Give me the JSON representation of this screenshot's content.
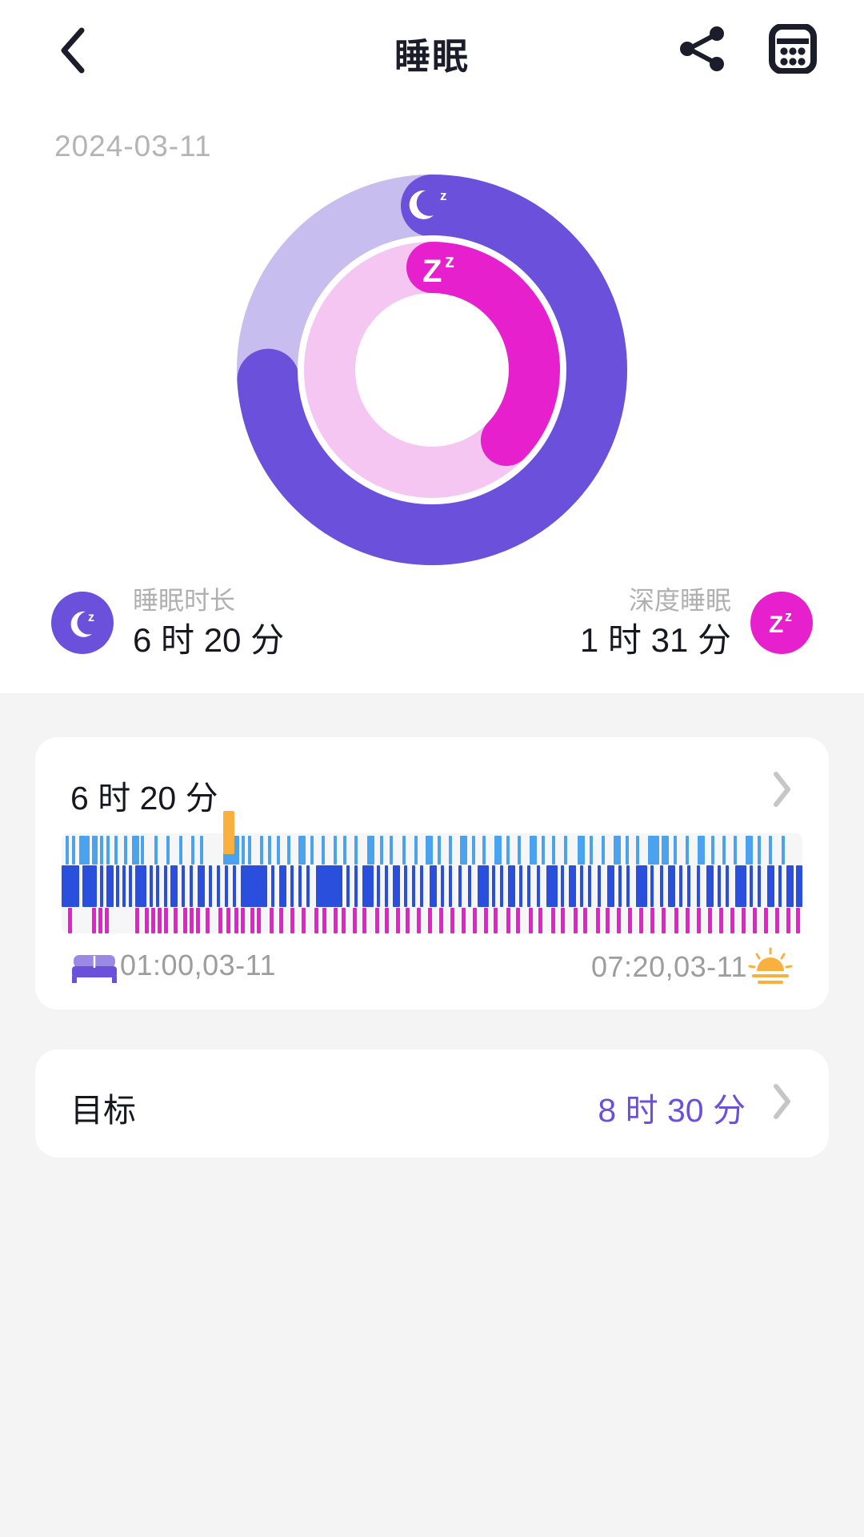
{
  "header": {
    "title": "睡眠",
    "back_icon": "chevron-left-icon",
    "share_icon": "share-icon",
    "calendar_icon": "calendar-icon"
  },
  "date": "2024-03-11",
  "rings": {
    "sleep_badge_icon": "moon-z-icon",
    "deep_badge_icon": "zz-icon",
    "outer_track_color": "#c7bdee",
    "outer_fill_color": "#6b50dc",
    "inner_track_color": "#f4c6f1",
    "inner_fill_color": "#e520cc"
  },
  "stats": [
    {
      "icon": "moon-z-icon",
      "label": "睡眠时长",
      "value": "6 时 20 分",
      "color": "#6b50dc"
    },
    {
      "icon": "zz-icon",
      "label": "深度睡眠",
      "value": "1 时 31 分",
      "color": "#e520cc"
    }
  ],
  "sleep_card": {
    "title": "6 时 20 分",
    "chevron_icon": "chevron-right-icon",
    "start_icon": "bed-icon",
    "start_time": "01:00,03-11",
    "end_time": "07:20,03-11",
    "end_icon": "sunrise-icon"
  },
  "goal_card": {
    "label": "目标",
    "value": "8 时 30 分",
    "chevron_icon": "chevron-right-icon"
  },
  "chart_data": {
    "type": "bar",
    "title": "睡眠阶段 (Sleep stages hypnogram)",
    "xlabel": "",
    "ylabel": "",
    "x_start": "01:00,03-11",
    "x_end": "07:20,03-11",
    "grid": false,
    "legend_position": "none",
    "stage_colors": {
      "awake": "#4ba3ef",
      "light": "#2b4fdd",
      "deep": "#e520cc",
      "marker": "#f9b03e"
    },
    "categories": [
      "awake",
      "light",
      "deep",
      "marker"
    ],
    "series": [
      {
        "name": "awake",
        "color": "#4ba3ef",
        "values": [
          [
            5,
            4
          ],
          [
            13,
            4
          ],
          [
            22,
            9
          ],
          [
            31,
            4
          ],
          [
            38,
            7
          ],
          [
            48,
            4
          ],
          [
            56,
            4
          ],
          [
            66,
            4
          ],
          [
            78,
            4
          ],
          [
            88,
            9
          ],
          [
            99,
            4
          ],
          [
            116,
            4
          ],
          [
            131,
            4
          ],
          [
            147,
            4
          ],
          [
            162,
            4
          ],
          [
            173,
            4
          ],
          [
            202,
            19
          ],
          [
            213,
            9
          ],
          [
            225,
            4
          ],
          [
            233,
            4
          ],
          [
            248,
            4
          ],
          [
            258,
            4
          ],
          [
            269,
            4
          ],
          [
            282,
            4
          ],
          [
            296,
            9
          ],
          [
            311,
            4
          ],
          [
            325,
            4
          ],
          [
            340,
            4
          ],
          [
            352,
            4
          ],
          [
            366,
            4
          ],
          [
            382,
            9
          ],
          [
            398,
            4
          ],
          [
            410,
            4
          ],
          [
            426,
            4
          ],
          [
            441,
            4
          ],
          [
            455,
            9
          ],
          [
            470,
            4
          ],
          [
            484,
            4
          ],
          [
            498,
            9
          ],
          [
            513,
            4
          ],
          [
            526,
            4
          ],
          [
            541,
            9
          ],
          [
            556,
            4
          ],
          [
            570,
            4
          ],
          [
            585,
            9
          ],
          [
            600,
            4
          ],
          [
            613,
            4
          ],
          [
            628,
            4
          ],
          [
            645,
            9
          ],
          [
            660,
            4
          ],
          [
            675,
            4
          ],
          [
            690,
            9
          ],
          [
            705,
            4
          ],
          [
            718,
            4
          ],
          [
            733,
            14
          ],
          [
            750,
            9
          ],
          [
            765,
            4
          ],
          [
            780,
            4
          ],
          [
            795,
            9
          ],
          [
            812,
            4
          ],
          [
            826,
            4
          ],
          [
            840,
            4
          ],
          [
            855,
            9
          ],
          [
            870,
            4
          ],
          [
            884,
            4
          ],
          [
            900,
            4
          ]
        ]
      },
      {
        "name": "light",
        "color": "#2b4fdd",
        "values": [
          [
            0,
            22
          ],
          [
            26,
            18
          ],
          [
            48,
            4
          ],
          [
            56,
            9
          ],
          [
            68,
            4
          ],
          [
            76,
            4
          ],
          [
            84,
            4
          ],
          [
            92,
            14
          ],
          [
            110,
            4
          ],
          [
            118,
            4
          ],
          [
            128,
            4
          ],
          [
            136,
            9
          ],
          [
            150,
            4
          ],
          [
            160,
            4
          ],
          [
            170,
            9
          ],
          [
            184,
            4
          ],
          [
            194,
            4
          ],
          [
            204,
            4
          ],
          [
            214,
            4
          ],
          [
            224,
            33
          ],
          [
            262,
            4
          ],
          [
            272,
            9
          ],
          [
            286,
            4
          ],
          [
            296,
            4
          ],
          [
            306,
            4
          ],
          [
            318,
            33
          ],
          [
            356,
            4
          ],
          [
            366,
            4
          ],
          [
            376,
            14
          ],
          [
            394,
            4
          ],
          [
            404,
            4
          ],
          [
            414,
            9
          ],
          [
            428,
            4
          ],
          [
            438,
            4
          ],
          [
            448,
            4
          ],
          [
            460,
            9
          ],
          [
            474,
            4
          ],
          [
            484,
            4
          ],
          [
            496,
            4
          ],
          [
            508,
            4
          ],
          [
            520,
            14
          ],
          [
            538,
            4
          ],
          [
            548,
            4
          ],
          [
            558,
            9
          ],
          [
            572,
            4
          ],
          [
            582,
            4
          ],
          [
            594,
            4
          ],
          [
            606,
            14
          ],
          [
            624,
            4
          ],
          [
            634,
            9
          ],
          [
            648,
            4
          ],
          [
            658,
            4
          ],
          [
            670,
            4
          ],
          [
            682,
            9
          ],
          [
            696,
            4
          ],
          [
            706,
            4
          ],
          [
            718,
            14
          ],
          [
            736,
            4
          ],
          [
            748,
            4
          ],
          [
            758,
            9
          ],
          [
            772,
            4
          ],
          [
            782,
            4
          ],
          [
            794,
            4
          ],
          [
            806,
            9
          ],
          [
            820,
            4
          ],
          [
            830,
            4
          ],
          [
            842,
            14
          ],
          [
            860,
            4
          ],
          [
            870,
            4
          ],
          [
            882,
            9
          ],
          [
            896,
            4
          ],
          [
            906,
            9
          ],
          [
            918,
            8
          ]
        ]
      },
      {
        "name": "deep",
        "color": "#e520cc",
        "values": [
          [
            8,
            5
          ],
          [
            38,
            5
          ],
          [
            46,
            5
          ],
          [
            54,
            5
          ],
          [
            92,
            5
          ],
          [
            104,
            5
          ],
          [
            112,
            5
          ],
          [
            120,
            5
          ],
          [
            128,
            5
          ],
          [
            140,
            5
          ],
          [
            152,
            5
          ],
          [
            160,
            5
          ],
          [
            168,
            5
          ],
          [
            180,
            5
          ],
          [
            196,
            5
          ],
          [
            206,
            5
          ],
          [
            216,
            5
          ],
          [
            224,
            5
          ],
          [
            236,
            5
          ],
          [
            244,
            5
          ],
          [
            260,
            5
          ],
          [
            272,
            5
          ],
          [
            286,
            5
          ],
          [
            300,
            5
          ],
          [
            316,
            5
          ],
          [
            326,
            5
          ],
          [
            340,
            5
          ],
          [
            350,
            5
          ],
          [
            364,
            5
          ],
          [
            376,
            5
          ],
          [
            392,
            5
          ],
          [
            404,
            5
          ],
          [
            418,
            5
          ],
          [
            430,
            5
          ],
          [
            444,
            5
          ],
          [
            458,
            5
          ],
          [
            472,
            5
          ],
          [
            486,
            5
          ],
          [
            500,
            5
          ],
          [
            514,
            5
          ],
          [
            528,
            5
          ],
          [
            540,
            5
          ],
          [
            556,
            5
          ],
          [
            568,
            5
          ],
          [
            584,
            5
          ],
          [
            596,
            5
          ],
          [
            612,
            5
          ],
          [
            624,
            5
          ],
          [
            640,
            5
          ],
          [
            652,
            5
          ],
          [
            668,
            5
          ],
          [
            680,
            5
          ],
          [
            694,
            5
          ],
          [
            708,
            5
          ],
          [
            722,
            5
          ],
          [
            736,
            5
          ],
          [
            750,
            5
          ],
          [
            766,
            5
          ],
          [
            780,
            5
          ],
          [
            794,
            5
          ],
          [
            808,
            5
          ],
          [
            822,
            5
          ],
          [
            836,
            5
          ],
          [
            850,
            5
          ],
          [
            864,
            5
          ],
          [
            878,
            5
          ],
          [
            892,
            5
          ],
          [
            906,
            5
          ],
          [
            918,
            5
          ]
        ]
      },
      {
        "name": "marker",
        "color": "#f9b03e",
        "values": [
          [
            202,
            14
          ]
        ]
      }
    ]
  }
}
